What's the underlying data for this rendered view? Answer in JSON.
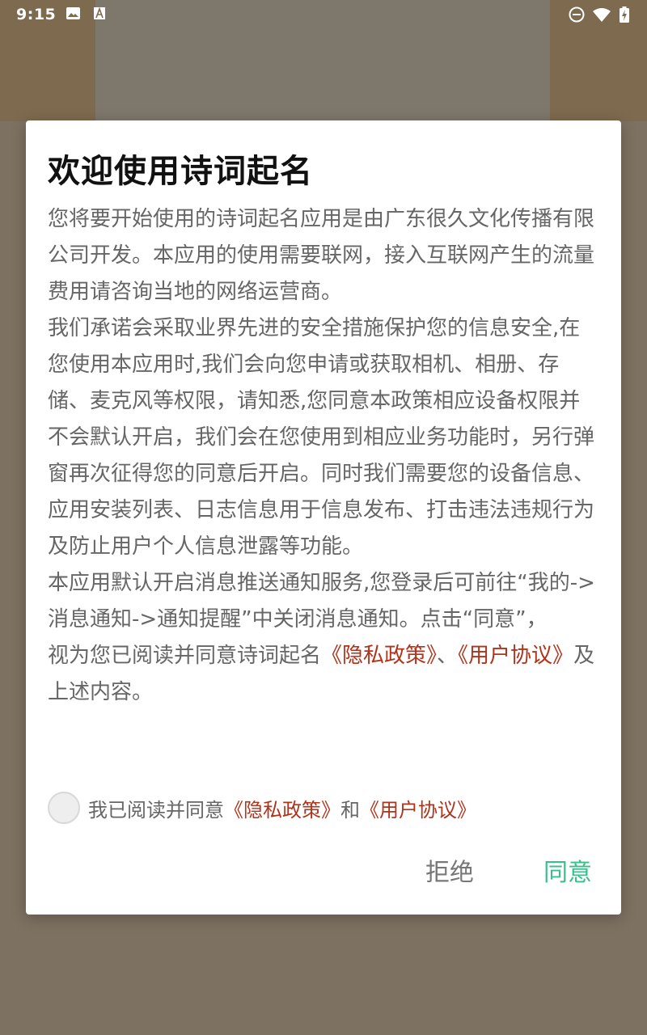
{
  "status_bar": {
    "time": "9:15",
    "icons": [
      "image-icon",
      "font-a-icon",
      "do-not-disturb-icon",
      "wifi-icon",
      "battery-charging-icon"
    ]
  },
  "dialog": {
    "title": "欢迎使用诗词起名",
    "paragraph1": "您将要开始使用的诗词起名应用是由广东很久文化传播有限公司开发。本应用的使用需要联网，接入互联网产生的流量费用请咨询当地的网络运营商。",
    "paragraph2": "我们承诺会采取业界先进的安全措施保护您的信息安全,在您使用本应用时,我们会向您申请或获取相机、相册、存储、麦克风等权限，请知悉,您同意本政策相应设备权限并不会默认开启，我们会在您使用到相应业务功能时，另行弹窗再次征得您的同意后开启。同时我们需要您的设备信息、应用安装列表、日志信息用于信息发布、打击违法违规行为及防止用户个人信息泄露等功能。",
    "paragraph3": "本应用默认开启消息推送通知服务,您登录后可前往“我的->消息通知->通知提醒”中关闭消息通知。点击“同意”，",
    "paragraph4_prefix": "视为您已阅读并同意诗词起名",
    "privacy_link": "《隐私政策》",
    "separator": "、",
    "user_agreement_link": "《用户协议》",
    "paragraph4_suffix": "及上述内容。",
    "agree_row": {
      "prefix": "我已阅读并同意",
      "privacy_link": "《隐私政策》",
      "and": "和",
      "user_agreement_link": "《用户协议》"
    },
    "refuse_label": "拒绝",
    "agree_label": "同意"
  },
  "colors": {
    "link": "#b0331b",
    "agree_button": "#3bbf8a",
    "scrim": "#7d7162"
  }
}
